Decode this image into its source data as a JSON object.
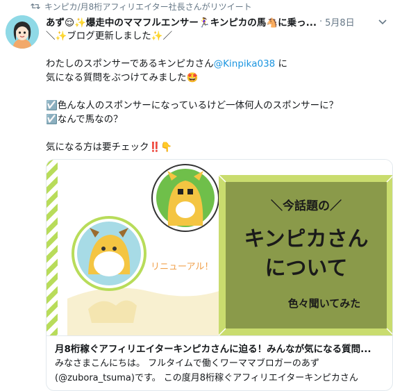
{
  "retweet": {
    "text": "キンピカ/月8桁アフィリエイター社長さんがリツイート",
    "icon": "retweet-icon"
  },
  "tweet": {
    "display_name": "あず😌✨爆走中のママフルエンサー🏃‍♀️キンピカの馬🐴に乗っ...",
    "separator": "·",
    "date": "5月8日",
    "lines": {
      "l1": "＼✨ブログ更新しました✨／",
      "l2_pre": "わたしのスポンサーであるキンピカさん",
      "l2_mention": "@Kinpika038",
      "l2_post": " に",
      "l3": "気になる質問をぶつけてみました🤩",
      "l4": "☑️色んな人のスポンサーになっているけど一体何人のスポンサーに？",
      "l5": "☑️なんで馬なの？",
      "l6": "気になる方は要チェック‼️👇"
    }
  },
  "card": {
    "image": {
      "kicker": "＼今話題の／",
      "title_line1": "キンピカさん",
      "title_line2": "について",
      "subtitle": "色々聞いてみた",
      "renewal": "リニューアル！"
    },
    "title": "月8桁稼ぐアフィリエイターキンピカさんに迫る！みんなが気になる質問...",
    "desc_line1": "みなさまこんにちは。 フルタイムで働くワーママブロガーのあず",
    "desc_line2": "(@zubora_tsuma)です。 この度月8桁稼ぐアフィリエイターキンピカさん"
  },
  "colors": {
    "accent": "#1b95e0",
    "muted": "#657786",
    "board": "#8a9a4a",
    "board_frame": "#c9dc6e",
    "stripe": "#b8dc5a"
  }
}
